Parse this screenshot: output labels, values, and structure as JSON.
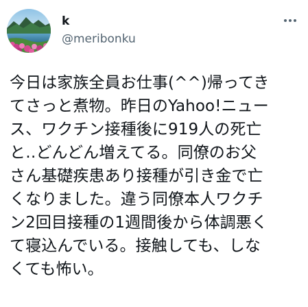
{
  "author": {
    "display_name": "k",
    "handle": "@meribonku",
    "avatar_icon": "landscape-avatar-icon"
  },
  "menu": {
    "icon": "more-options-icon"
  },
  "tweet": {
    "lines": [
      "今日は家族全員お仕事(^^)帰ってき",
      "てさっと煮物。昨日のYahoo!ニュー",
      "ス、ワクチン接種後に919人の死亡",
      "と‥どんどん増えてる。同僚のお父",
      "さん基礎疾患あり接種が引き金で亡",
      "くなりました。違う同僚本人ワクチ",
      "ン2回目接種の1週間後から体調悪く",
      "て寝込んでいる。接触しても、しな",
      "くても怖い。"
    ]
  },
  "colors": {
    "text": "#0f1419",
    "secondary": "#536471",
    "background": "#ffffff"
  }
}
